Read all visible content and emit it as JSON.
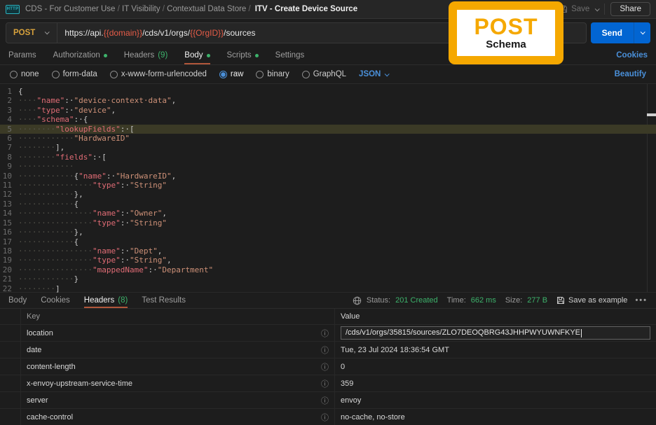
{
  "colors": {
    "method_post": "#d8a23c",
    "env_var": "#e55c48",
    "send_blue": "#0265d2",
    "link_blue": "#4a90da",
    "accent_orange": "#b0563a",
    "success_green": "#3db26b",
    "badge_yellow": "#f5a800"
  },
  "header": {
    "app_icon": "HTTP",
    "breadcrumb": [
      "CDS - For Customer Use",
      "IT Visibility",
      "Contextual Data Store"
    ],
    "breadcrumb_current": "ITV - Create Device Source",
    "save_label": "Save",
    "share_label": "Share"
  },
  "request": {
    "method": "POST",
    "url_parts": [
      {
        "text": "https://api.",
        "env": false
      },
      {
        "text": "{{domain}}",
        "env": true
      },
      {
        "text": "/cds/v1/orgs/",
        "env": false
      },
      {
        "text": "{{OrgID}}",
        "env": true
      },
      {
        "text": "/sources",
        "env": false
      }
    ],
    "send_label": "Send",
    "tabs": [
      {
        "label": "Params"
      },
      {
        "label": "Authorization",
        "dot": true
      },
      {
        "label": "Headers",
        "count": "(9)"
      },
      {
        "label": "Body",
        "dot": true,
        "active": true
      },
      {
        "label": "Scripts",
        "dot": true
      },
      {
        "label": "Settings"
      }
    ],
    "cookies_link": "Cookies",
    "body_modes": [
      "none",
      "form-data",
      "x-www-form-urlencoded",
      "raw",
      "binary",
      "GraphQL"
    ],
    "selected_mode": "raw",
    "language": "JSON",
    "beautify_link": "Beautify"
  },
  "editor": {
    "highlighted_line": 5,
    "lines": [
      "{",
      "    \"name\": \"device context data\",",
      "    \"type\": \"device\",",
      "    \"schema\": {",
      "        \"lookupFields\": [",
      "            \"HardwareID\"",
      "        ],",
      "        \"fields\": [",
      "            ",
      "            {\"name\": \"HardwareID\",",
      "                \"type\": \"String\"",
      "            },",
      "            {",
      "                \"name\": \"Owner\",",
      "                \"type\": \"String\"",
      "            },",
      "            {",
      "                \"name\": \"Dept\",",
      "                \"type\": \"String\",",
      "                \"mappedName\": \"Department\"",
      "            }",
      "        ]"
    ]
  },
  "response": {
    "tabs": [
      {
        "label": "Body"
      },
      {
        "label": "Cookies"
      },
      {
        "label": "Headers",
        "count": "(8)",
        "active": true
      },
      {
        "label": "Test Results"
      }
    ],
    "status_label": "Status:",
    "status_value": "201 Created",
    "time_label": "Time:",
    "time_value": "662 ms",
    "size_label": "Size:",
    "size_value": "277 B",
    "save_as_example_label": "Save as example",
    "more_label": "•••",
    "table": {
      "columns": [
        "Key",
        "Value"
      ],
      "rows": [
        {
          "key": "location",
          "value": "/cds/v1/orgs/35815/sources/ZLO7DEOQBRG43JHHPWYUWNFKYE",
          "selected": true
        },
        {
          "key": "date",
          "value": "Tue, 23 Jul 2024 18:36:54 GMT"
        },
        {
          "key": "content-length",
          "value": "0"
        },
        {
          "key": "x-envoy-upstream-service-time",
          "value": "359"
        },
        {
          "key": "server",
          "value": "envoy"
        },
        {
          "key": "cache-control",
          "value": "no-cache, no-store"
        }
      ]
    }
  },
  "overlay": {
    "title": "POST",
    "subtitle": "Schema"
  }
}
